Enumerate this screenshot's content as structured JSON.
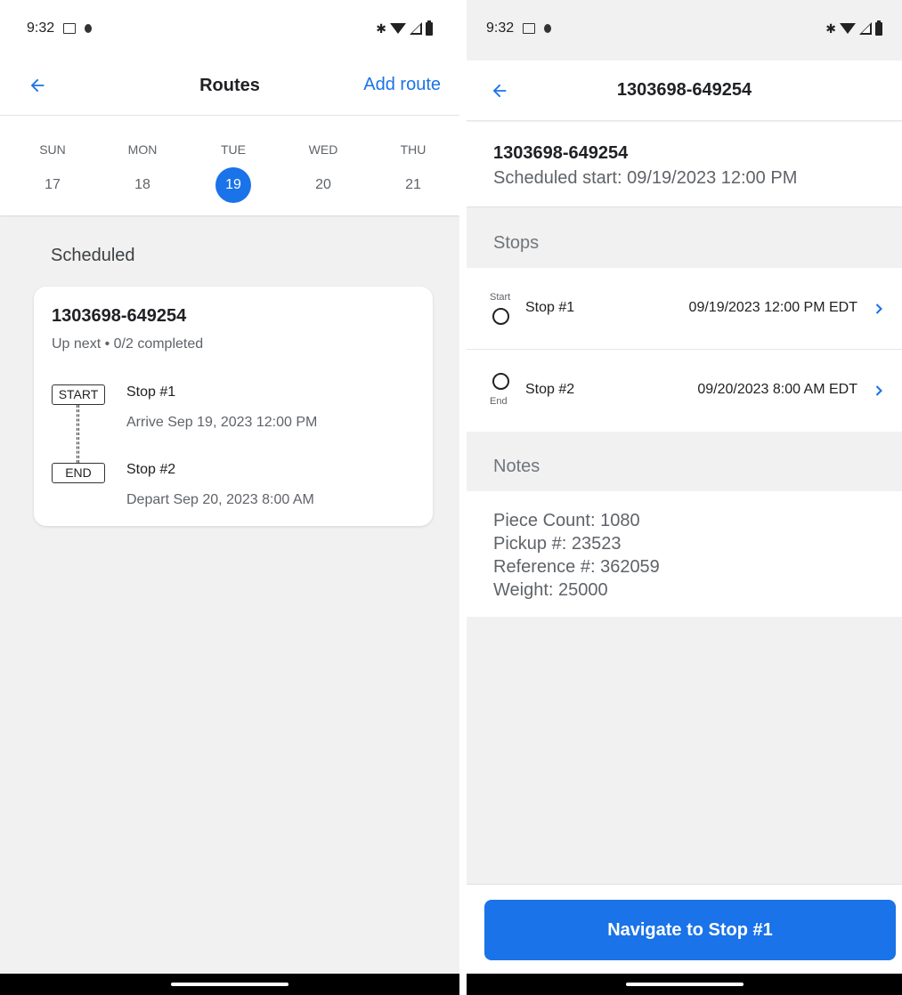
{
  "left": {
    "status": {
      "time": "9:32"
    },
    "header": {
      "title": "Routes",
      "action": "Add route"
    },
    "week": [
      {
        "name": "SUN",
        "num": "17"
      },
      {
        "name": "MON",
        "num": "18"
      },
      {
        "name": "TUE",
        "num": "19",
        "selected": true
      },
      {
        "name": "WED",
        "num": "20"
      },
      {
        "name": "THU",
        "num": "21"
      }
    ],
    "section": "Scheduled",
    "card": {
      "title": "1303698-649254",
      "subtitle": "Up next • 0/2 completed",
      "start_tag": "START",
      "end_tag": "END",
      "stop1": {
        "name": "Stop #1",
        "time": "Arrive Sep 19, 2023 12:00 PM"
      },
      "stop2": {
        "name": "Stop #2",
        "time": "Depart Sep 20, 2023 8:00 AM"
      }
    }
  },
  "right": {
    "status": {
      "time": "9:32"
    },
    "header": {
      "title": "1303698-649254"
    },
    "info": {
      "route_id": "1303698-649254",
      "scheduled": "Scheduled start: 09/19/2023 12:00 PM"
    },
    "stops_label": "Stops",
    "stops": [
      {
        "badge": "Start",
        "name": "Stop #1",
        "time": "09/19/2023 12:00 PM EDT"
      },
      {
        "badge": "End",
        "name": "Stop #2",
        "time": "09/20/2023 8:00 AM EDT"
      }
    ],
    "notes_label": "Notes",
    "notes": [
      "Piece Count: 1080",
      "Pickup #: 23523",
      "Reference #: 362059",
      "Weight: 25000"
    ],
    "button": "Navigate to Stop #1"
  },
  "colors": {
    "accent": "#1a73e8",
    "background": "#f1f1f1",
    "text_secondary": "#5f6368"
  }
}
